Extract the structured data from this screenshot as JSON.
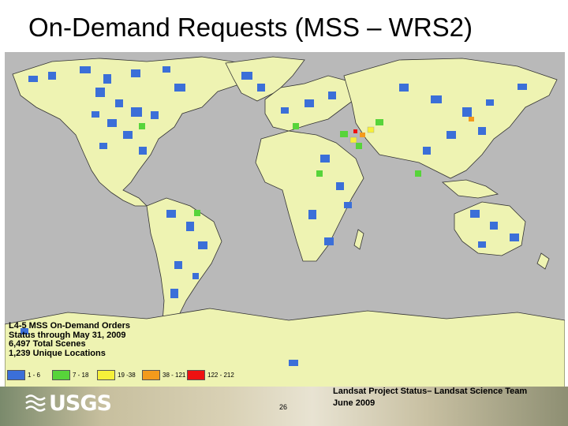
{
  "slide": {
    "title": "On-Demand Requests (MSS – WRS2)",
    "page_number": "26",
    "footer_line1": "Landsat Project Status– Landsat Science Team",
    "footer_line2": "June 2009"
  },
  "logo": {
    "text": "USGS",
    "icon": "usgs-wave-icon"
  },
  "legend": {
    "title": "L4-5 MSS On-Demand Orders",
    "status": "Status through May 31, 2009",
    "total_scenes": "6,497 Total Scenes",
    "unique_locations": "1,239 Unique Locations",
    "classes": [
      {
        "label": "1 - 6",
        "color": "#3b6fd8"
      },
      {
        "label": "7 - 18",
        "color": "#57d43a"
      },
      {
        "label": "19 -38",
        "color": "#f6f03a"
      },
      {
        "label": "38 - 121",
        "color": "#f39a1c"
      },
      {
        "label": "122 - 212",
        "color": "#ee1111"
      }
    ]
  },
  "colors": {
    "land": "#eef3b2",
    "ocean": "#b9b9b9",
    "borders": "#333333"
  }
}
